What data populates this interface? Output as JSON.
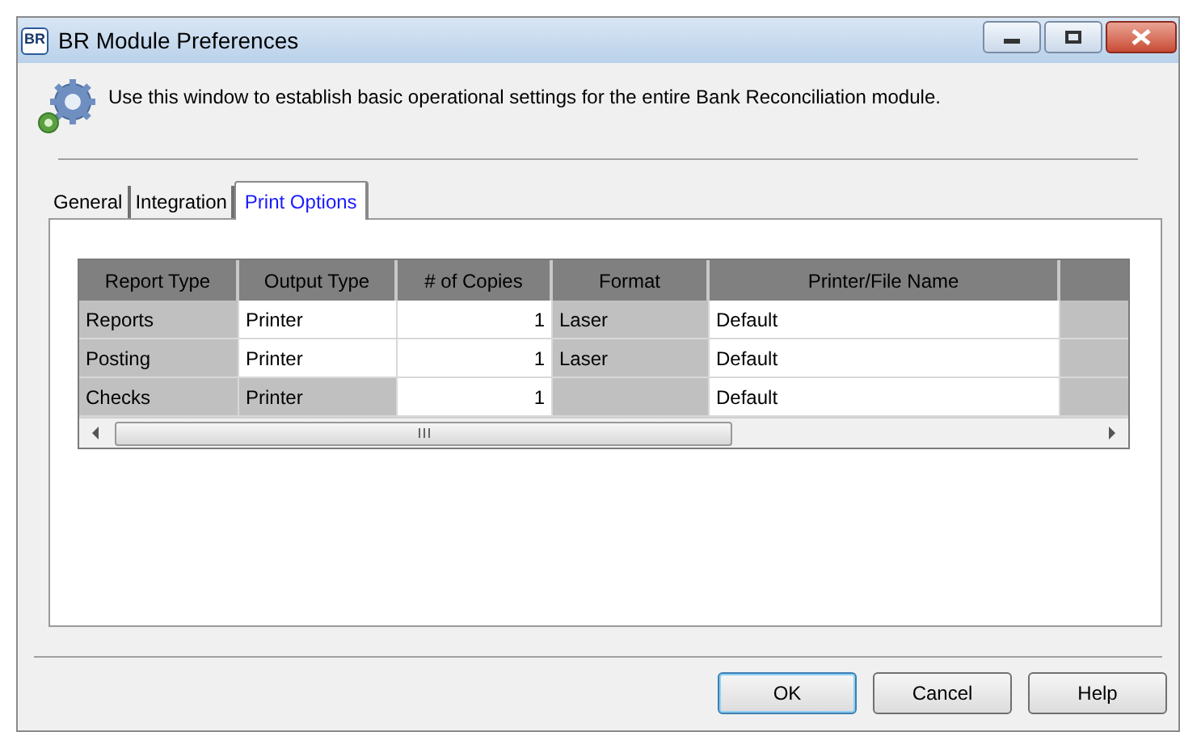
{
  "window": {
    "title": "BR Module Preferences",
    "icon_text": "BR"
  },
  "intro": "Use this window to establish basic operational settings for the entire Bank Reconciliation module.",
  "tabs": [
    {
      "label": "General",
      "selected": false
    },
    {
      "label": "Integration",
      "selected": false
    },
    {
      "label": "Print Options",
      "selected": true
    }
  ],
  "table": {
    "columns": [
      "Report Type",
      "Output Type",
      "# of Copies",
      "Format",
      "Printer/File Name"
    ],
    "rows": [
      {
        "cells": [
          {
            "text": "Reports",
            "editable": false
          },
          {
            "text": "Printer",
            "editable": true
          },
          {
            "text": "1",
            "editable": true
          },
          {
            "text": "Laser",
            "editable": false
          },
          {
            "text": "Default",
            "editable": true
          }
        ]
      },
      {
        "cells": [
          {
            "text": "Posting",
            "editable": false
          },
          {
            "text": "Printer",
            "editable": true
          },
          {
            "text": "1",
            "editable": true
          },
          {
            "text": "Laser",
            "editable": false
          },
          {
            "text": "Default",
            "editable": true
          }
        ]
      },
      {
        "cells": [
          {
            "text": "Checks",
            "editable": false
          },
          {
            "text": "Printer",
            "editable": false
          },
          {
            "text": "1",
            "editable": true
          },
          {
            "editable": false
          },
          {
            "text": "Default",
            "editable": true
          }
        ]
      }
    ]
  },
  "buttons": [
    {
      "label": "OK",
      "default": true
    },
    {
      "label": "Cancel",
      "default": false
    },
    {
      "label": "Help",
      "default": false
    }
  ]
}
